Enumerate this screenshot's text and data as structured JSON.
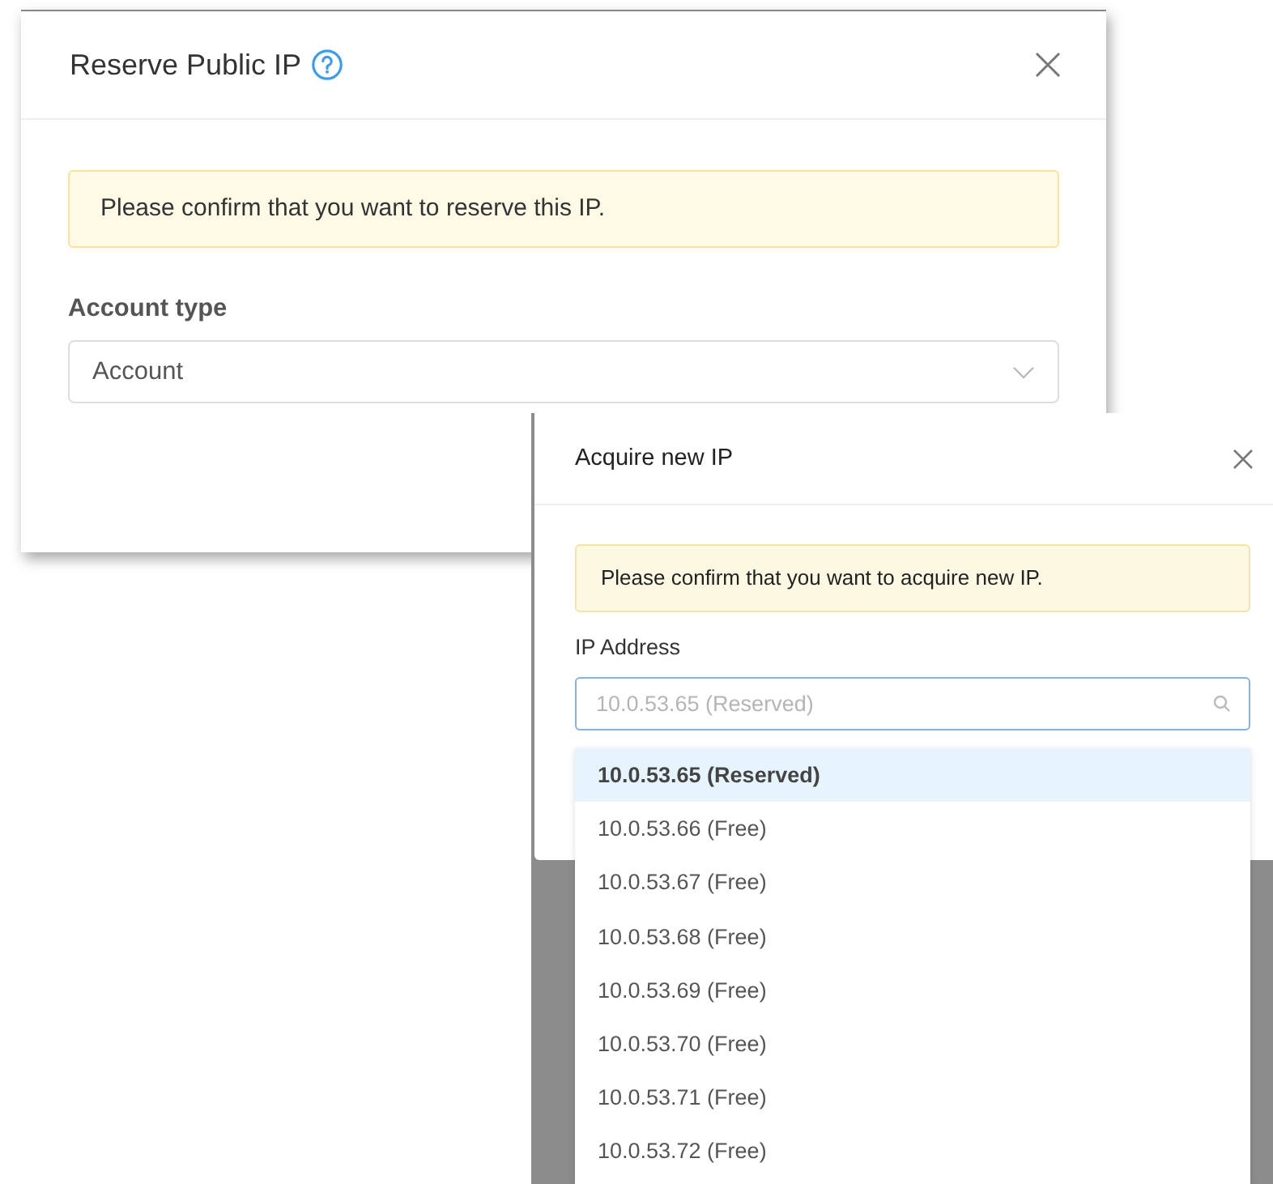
{
  "reserve_dialog": {
    "title": "Reserve Public IP",
    "alert": "Please confirm that you want to reserve this IP.",
    "field_label": "Account type",
    "select_value": "Account"
  },
  "acquire_dialog": {
    "title": "Acquire new IP",
    "alert": "Please confirm that you want to acquire new IP.",
    "field_label": "IP Address",
    "placeholder": "10.0.53.65 (Reserved)",
    "options": [
      {
        "label": "10.0.53.65 (Reserved)",
        "selected": true
      },
      {
        "label": "10.0.53.66 (Free)",
        "selected": false
      },
      {
        "label": "10.0.53.67 (Free)",
        "selected": false
      },
      {
        "label": "10.0.53.68 (Free)",
        "selected": false
      },
      {
        "label": "10.0.53.69 (Free)",
        "selected": false
      },
      {
        "label": "10.0.53.70 (Free)",
        "selected": false
      },
      {
        "label": "10.0.53.71 (Free)",
        "selected": false
      },
      {
        "label": "10.0.53.72 (Free)",
        "selected": false
      }
    ]
  }
}
